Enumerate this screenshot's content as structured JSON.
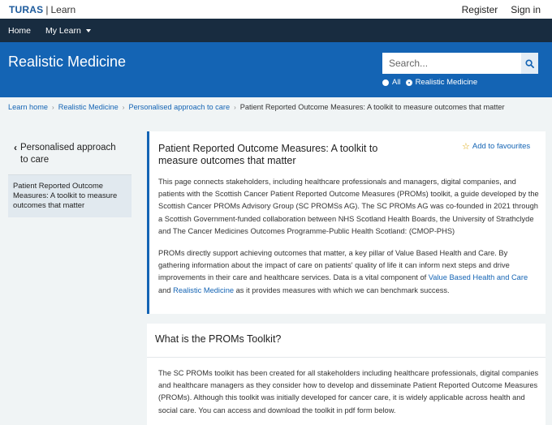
{
  "header": {
    "brand_name": "TURAS",
    "brand_separator": "|",
    "brand_product": "Learn",
    "register": "Register",
    "sign_in": "Sign in"
  },
  "nav": {
    "home": "Home",
    "my_learn": "My Learn"
  },
  "hero": {
    "title": "Realistic Medicine",
    "search_placeholder": "Search...",
    "scope_all": "All",
    "scope_current": "Realistic Medicine",
    "selected_scope": "Realistic Medicine"
  },
  "breadcrumb": [
    "Learn home",
    "Realistic Medicine",
    "Personalised approach to care",
    "Patient Reported Outcome Measures: A toolkit to measure outcomes that matter"
  ],
  "sidebar": {
    "back_label": "Personalised approach to care",
    "active_item": "Patient Reported Outcome Measures: A toolkit to measure outcomes that matter"
  },
  "main": {
    "title": "Patient Reported Outcome Measures: A toolkit to measure outcomes that matter",
    "favourite": "Add to favourites",
    "paragraph1": "This page connects stakeholders, including healthcare professionals and managers, digital companies, and patients with the Scottish Cancer Patient Reported Outcome Measures (PROMs) toolkit, a guide developed by the Scottish Cancer PROMs Advisory Group (SC PROMSs AG). The SC PROMs AG was co-founded in 2021 through a Scottish Government-funded collaboration between NHS Scotland Health Boards, the University of Strathclyde and The Cancer Medicines Outcomes Programme-Public Health Scotland: (CMOP-PHS)",
    "paragraph2_start": "PROMs directly support achieving outcomes that matter, a key pillar of Value Based Health and Care. By gathering information about the impact of care on patients' quality of life it can inform next steps and drive improvements in their care and healthcare services. Data is a vital component of",
    "link_vbhc": "Value Based Health and Care",
    "and": "and",
    "link_rm": "Realistic Medicine",
    "paragraph2_end": "as it provides measures with which we can benchmark success."
  },
  "section2": {
    "title": "What is the PROMs Toolkit?",
    "paragraph": "The SC PROMs toolkit has been created for all stakeholders including healthcare professionals, digital companies and healthcare managers as they consider how to develop and disseminate Patient Reported Outcome Measures (PROMs). Although this toolkit was initially developed  for cancer care, it is widely applicable across health and social care. You can access and download the toolkit in pdf form below."
  },
  "colors": {
    "nav_bg": "#182c40",
    "hero_bg": "#1464b4",
    "link": "#1464b4",
    "page_bg": "#f0f4f5"
  },
  "icons": {
    "search": "search-icon",
    "star": "star-outline-icon",
    "back": "chevron-left-icon",
    "dropdown": "caret-down-icon"
  }
}
